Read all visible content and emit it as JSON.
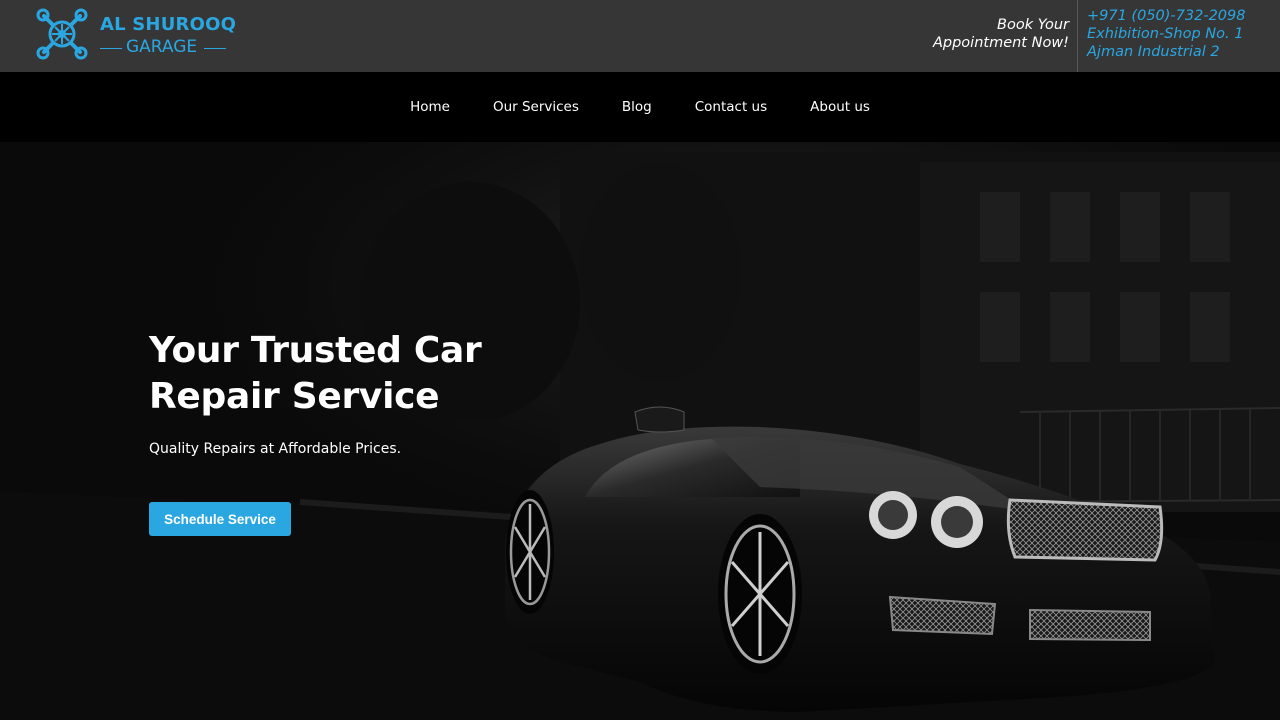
{
  "brand": {
    "line1": "AL SHUROOQ",
    "line2": "GARAGE",
    "logo_icon": "wrench-wheel-icon",
    "accent": "#2aa7e1"
  },
  "header": {
    "book_line1": "Book Your",
    "book_line2": "Appointment Now!",
    "phone": "+971 (050)-732-2098",
    "address_line1": "Exhibition-Shop No. 1",
    "address_line2": "Ajman Industrial 2"
  },
  "nav": {
    "items": [
      {
        "label": "Home"
      },
      {
        "label": "Our Services"
      },
      {
        "label": "Blog"
      },
      {
        "label": "Contact us"
      },
      {
        "label": "About us"
      }
    ]
  },
  "hero": {
    "title_line1": "Your Trusted Car",
    "title_line2": "Repair Service",
    "subtitle": "Quality Repairs at Affordable Prices.",
    "cta_label": "Schedule Service",
    "background_image": "black-luxury-car-on-dark-street"
  },
  "colors": {
    "topbar": "#363636",
    "hero_background": "#000000",
    "button": "#2aa7e1"
  }
}
